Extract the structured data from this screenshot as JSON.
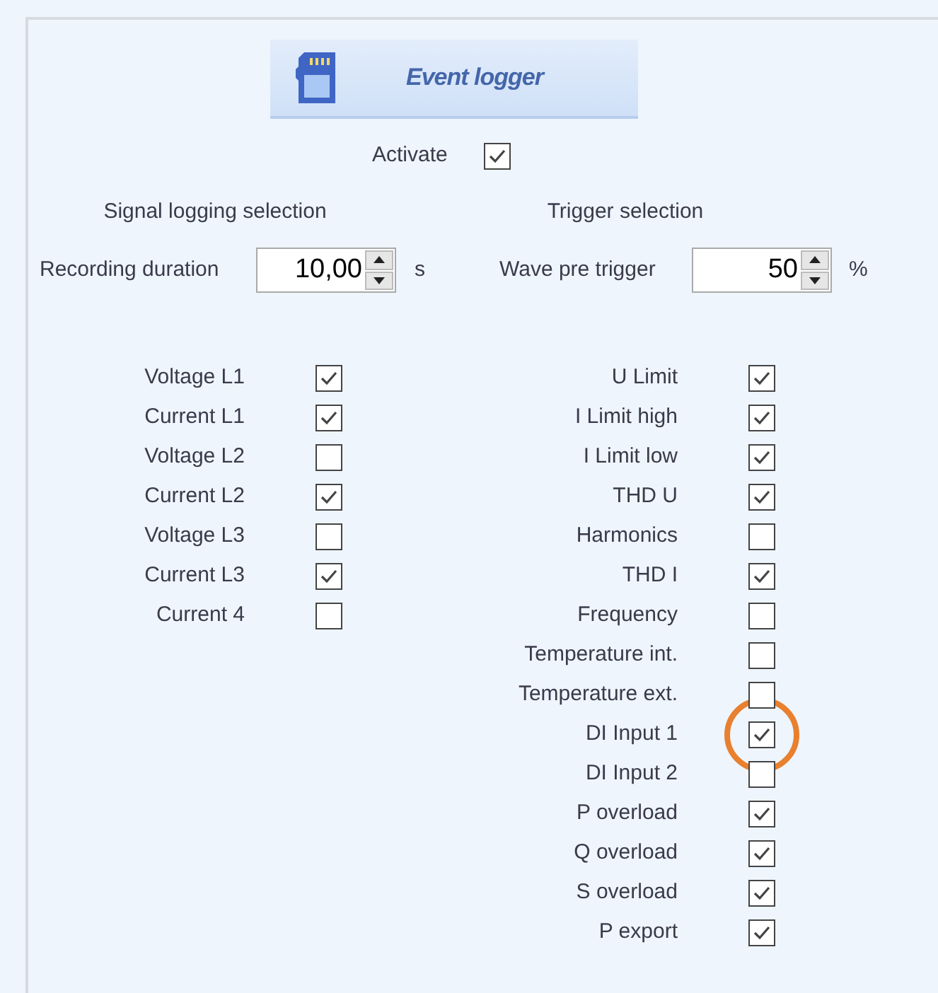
{
  "header": {
    "title": "Event logger"
  },
  "activate": {
    "label": "Activate",
    "checked": true
  },
  "signal_section": {
    "heading": "Signal logging selection",
    "field": {
      "label": "Recording duration",
      "value": "10,00",
      "unit": "s"
    },
    "items": [
      {
        "label": "Voltage L1",
        "checked": true
      },
      {
        "label": "Current L1",
        "checked": true
      },
      {
        "label": "Voltage L2",
        "checked": false
      },
      {
        "label": "Current L2",
        "checked": true
      },
      {
        "label": "Voltage L3",
        "checked": false
      },
      {
        "label": "Current L3",
        "checked": true
      },
      {
        "label": "Current 4",
        "checked": false
      }
    ]
  },
  "trigger_section": {
    "heading": "Trigger selection",
    "field": {
      "label": "Wave pre trigger",
      "value": "50",
      "unit": "%"
    },
    "items": [
      {
        "label": "U Limit",
        "checked": true,
        "highlighted": false
      },
      {
        "label": "I Limit high",
        "checked": true,
        "highlighted": false
      },
      {
        "label": "I Limit low",
        "checked": true,
        "highlighted": false
      },
      {
        "label": "THD U",
        "checked": true,
        "highlighted": false
      },
      {
        "label": "Harmonics",
        "checked": false,
        "highlighted": false
      },
      {
        "label": "THD I",
        "checked": true,
        "highlighted": false
      },
      {
        "label": "Frequency",
        "checked": false,
        "highlighted": false
      },
      {
        "label": "Temperature int.",
        "checked": false,
        "highlighted": false
      },
      {
        "label": "Temperature ext.",
        "checked": false,
        "highlighted": false
      },
      {
        "label": "DI Input 1",
        "checked": true,
        "highlighted": true
      },
      {
        "label": "DI Input 2",
        "checked": false,
        "highlighted": false
      },
      {
        "label": "P overload",
        "checked": true,
        "highlighted": false
      },
      {
        "label": "Q overload",
        "checked": true,
        "highlighted": false
      },
      {
        "label": "S overload",
        "checked": true,
        "highlighted": false
      },
      {
        "label": "P export",
        "checked": true,
        "highlighted": false
      }
    ]
  }
}
